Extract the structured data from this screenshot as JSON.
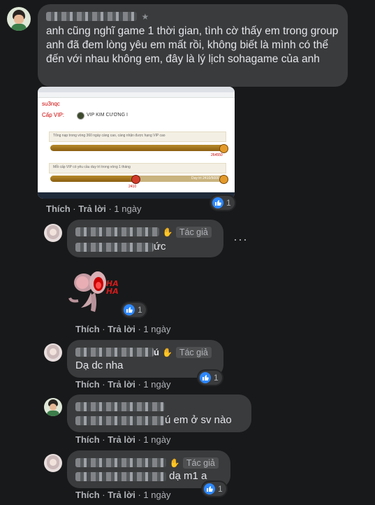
{
  "post": {
    "comment_text": "anh cũng nghĩ game 1 thời gian, tình cờ thấy em trong group anh đã đem lòng yêu em mất rồi, không biết là mình có thể đến với nhau không em, đây là lý lịch sohagame của anh",
    "screenshot": {
      "username": "su3nqc",
      "vip_label": "Cấp VIP:",
      "vip_level": "VIP KIM CƯƠNG I",
      "row1_text": "Tổng nạp trong vòng 360 ngày càng cao, càng nhận được hạng VIP cao",
      "row1_value": "264550",
      "row2_text": "Mỗi cấp VIP có yêu cầu duy trì trong vòng 1 tháng",
      "row2_bar": "Duy trì 2410/5000",
      "row2_value": "2410",
      "progress1": 1.0,
      "progress2": 0.48
    },
    "actions": {
      "like": "Thích",
      "reply": "Trả lời",
      "time": "1 ngày"
    },
    "reaction_count": "1",
    "colors": {
      "accent": "#2d88ff",
      "bubble": "#3a3b3c",
      "background": "#18191a"
    }
  },
  "replies": [
    {
      "author_badge": "Tác giả",
      "text_suffix": "ức",
      "like": "Thích",
      "reply": "Trả lời",
      "time": "1 ngày",
      "reaction_count": "1",
      "sticker_text": "HA HA"
    },
    {
      "author_badge": "Tác giả",
      "name_suffix": "ú",
      "text": "Dạ dc nha",
      "like": "Thích",
      "reply": "Trả lời",
      "time": "1 ngày",
      "reaction_count": "1"
    },
    {
      "text_suffix": "ú em ở sv nào",
      "like": "Thích",
      "reply": "Trả lời",
      "time": "1 ngày"
    },
    {
      "author_badge": "Tác giả",
      "text_suffix": "dạ m1 a",
      "like": "Thích",
      "reply": "Trả lời",
      "time": "1 ngày",
      "reaction_count": "1"
    }
  ]
}
